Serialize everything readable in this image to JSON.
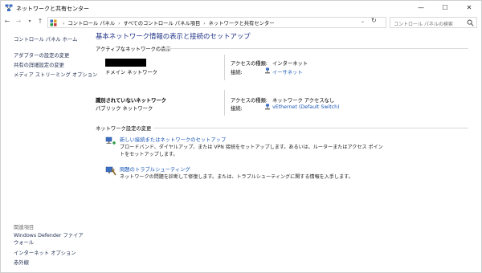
{
  "window": {
    "title": "ネットワークと共有センター",
    "min_glyph": "—",
    "max_glyph": "☐",
    "close_glyph": "✕"
  },
  "address": {
    "crumbs": [
      "コントロール パネル",
      "すべてのコントロール パネル項目",
      "ネットワークと共有センター"
    ],
    "search_placeholder": "コントロール パネルの検索"
  },
  "sidebar": {
    "home": "コントロール パネル ホーム",
    "links": [
      "アダプターの設定の変更",
      "共有の詳細設定の変更",
      "メディア ストリーミング オプション"
    ],
    "related_heading": "関連項目",
    "related": [
      "Windows Defender ファイアウォール",
      "インターネット オプション",
      "赤外線"
    ]
  },
  "main": {
    "title": "基本ネットワーク情報の表示と接続のセットアップ",
    "active_heading": "アクティブなネットワークの表示",
    "networks": [
      {
        "name": "",
        "category": "ドメイン ネットワーク",
        "access_label": "アクセスの種類:",
        "access_value": "インターネット",
        "conn_label": "接続:",
        "conn_value": "イーサネット"
      },
      {
        "name": "識別されていないネットワーク",
        "category": "パブリック ネットワーク",
        "access_label": "アクセスの種類:",
        "access_value": "ネットワーク アクセスなし",
        "conn_label": "接続:",
        "conn_value": "vEthernet (Default Switch)"
      }
    ],
    "change_heading": "ネットワーク設定の変更",
    "tasks": [
      {
        "link": "新しい接続またはネットワークのセットアップ",
        "desc": "ブロードバンド、ダイヤルアップ、または VPN 接続をセットアップします。あるいは、ルーターまたはアクセス ポイントをセットアップします。"
      },
      {
        "link": "問題のトラブルシューティング",
        "desc": "ネットワークの問題を診断して修復します。または、トラブルシューティングに関する情報を入手します。"
      }
    ]
  },
  "colors": {
    "title_blue": "#1e3287",
    "link_blue": "#1a57b6",
    "nav_text": "#1e2d4f"
  }
}
